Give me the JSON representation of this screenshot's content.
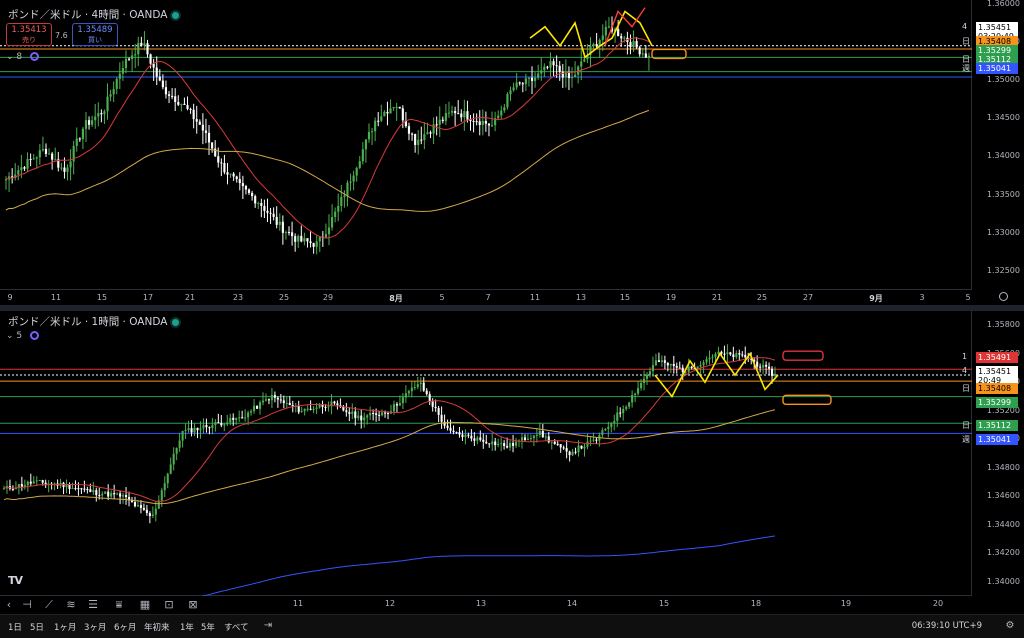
{
  "pane1": {
    "title": "ポンド／米ドル · 4時間 · OANDA",
    "sell": {
      "price": "1.35413",
      "label": "売り"
    },
    "buy": {
      "price": "1.35489",
      "label": "買い"
    },
    "spread": "7.6",
    "indicator_count": "8",
    "price_ticks": [
      "1.36000",
      "1.35500",
      "1.35000",
      "1.34500",
      "1.34000",
      "1.33500",
      "1.33000",
      "1.32500"
    ],
    "price_labels": [
      {
        "value": "1.35451",
        "sub": "03:20:49",
        "bg": "#ffffff",
        "fg": "#000000",
        "tag": "4"
      },
      {
        "value": "1.35408",
        "sub": "",
        "bg": "#f7931a",
        "fg": "#000000",
        "tag": "日"
      },
      {
        "value": "1.35299",
        "sub": "",
        "bg": "#2e9e4f",
        "fg": "#ffffff",
        "tag": ""
      },
      {
        "value": "1.35112",
        "sub": "",
        "bg": "#2e9e4f",
        "fg": "#ffffff",
        "tag": "日"
      },
      {
        "value": "1.35041",
        "sub": "",
        "bg": "#3355ff",
        "fg": "#ffffff",
        "tag": "週"
      }
    ],
    "x_ticks": [
      "9",
      "11",
      "15",
      "17",
      "21",
      "23",
      "25",
      "29",
      "8月",
      "5",
      "7",
      "11",
      "13",
      "15",
      "19",
      "21",
      "25",
      "27",
      "9月",
      "3",
      "5"
    ]
  },
  "pane2": {
    "title": "ポンド／米ドル · 1時間 · OANDA",
    "indicator_count": "5",
    "price_ticks": [
      "1.35800",
      "1.35600",
      "1.35400",
      "1.35200",
      "1.35000",
      "1.34800",
      "1.34600",
      "1.34400",
      "1.34200",
      "1.34000"
    ],
    "price_labels": [
      {
        "value": "1.35491",
        "sub": "",
        "bg": "#e03535",
        "fg": "#ffffff",
        "tag": "1"
      },
      {
        "value": "1.35451",
        "sub": "20:49",
        "bg": "#ffffff",
        "fg": "#000000",
        "tag": "4"
      },
      {
        "value": "1.35408",
        "sub": "",
        "bg": "#f7931a",
        "fg": "#000000",
        "tag": "日"
      },
      {
        "value": "1.35299",
        "sub": "",
        "bg": "#2e9e4f",
        "fg": "#ffffff",
        "tag": ""
      },
      {
        "value": "1.35112",
        "sub": "",
        "bg": "#2e9e4f",
        "fg": "#ffffff",
        "tag": "日"
      },
      {
        "value": "1.35041",
        "sub": "",
        "bg": "#3355ff",
        "fg": "#ffffff",
        "tag": "週"
      }
    ],
    "x_ticks": [
      "11",
      "12",
      "13",
      "14",
      "15",
      "18",
      "19",
      "20"
    ]
  },
  "bottom_bar": {
    "timeframes": [
      "1日",
      "5日",
      "1ヶ月",
      "3ヶ月",
      "6ヶ月",
      "年初来",
      "1年",
      "5年",
      "すべて"
    ],
    "clock": "06:39:10 UTC+9"
  },
  "logo": "TV",
  "colors": {
    "up": "#4caf50",
    "down": "#ffffff",
    "ma_fast": "#d83a3a",
    "ma_slow": "#d4a84a",
    "ma_blue": "#3355ff",
    "zigzag": "#ffe600",
    "zigzag_alt": "#ff3b3b",
    "box": "#f7931a"
  },
  "chart_data": [
    {
      "type": "candlestick",
      "title": "ポンド／米ドル · 4時間 · OANDA",
      "ylim": [
        1.3225,
        1.3605
      ],
      "x": [
        "9",
        "11",
        "15",
        "17",
        "21",
        "23",
        "25",
        "29",
        "8月",
        "5",
        "7",
        "11",
        "13",
        "15",
        "19",
        "21",
        "25",
        "27",
        "9月",
        "3",
        "5"
      ],
      "close_path": [
        1.337,
        1.339,
        1.341,
        1.338,
        1.344,
        1.346,
        1.352,
        1.355,
        1.349,
        1.347,
        1.344,
        1.339,
        1.336,
        1.334,
        1.331,
        1.329,
        1.3285,
        1.333,
        1.339,
        1.345,
        1.347,
        1.342,
        1.344,
        1.346,
        1.345,
        1.344,
        1.349,
        1.35,
        1.352,
        1.35,
        1.354,
        1.357,
        1.355,
        1.353
      ],
      "horizontal_levels": [
        1.35451,
        1.35408,
        1.35299,
        1.35112,
        1.35041
      ]
    },
    {
      "type": "candlestick",
      "title": "ポンド／米ドル · 1時間 · OANDA",
      "ylim": [
        1.339,
        1.359
      ],
      "x": [
        "11",
        "12",
        "13",
        "14",
        "15",
        "18",
        "19",
        "20"
      ],
      "close_path": [
        1.3465,
        1.347,
        1.3468,
        1.3463,
        1.346,
        1.3445,
        1.3505,
        1.351,
        1.3515,
        1.353,
        1.352,
        1.3525,
        1.3515,
        1.352,
        1.354,
        1.3505,
        1.35,
        1.3495,
        1.3505,
        1.349,
        1.35,
        1.3525,
        1.3555,
        1.3548,
        1.356,
        1.3558,
        1.3545
      ],
      "horizontal_levels": [
        1.35491,
        1.35451,
        1.35408,
        1.35299,
        1.35112,
        1.35041
      ]
    }
  ]
}
